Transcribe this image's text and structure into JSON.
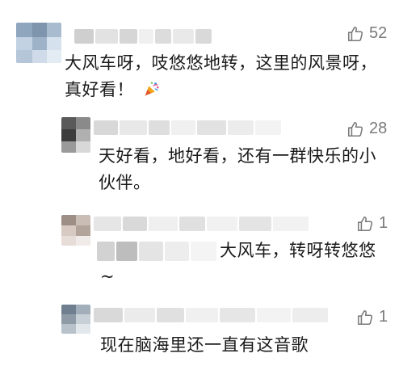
{
  "comments": [
    {
      "likes": "52",
      "lines": [
        "大风车呀，吱悠悠地转，这里的风景呀，",
        "真好看！"
      ],
      "emoji_icon": "party-popper-icon"
    },
    {
      "likes": "28",
      "lines": [
        "天好看，地好看，还有一群快乐的小",
        "伙伴。"
      ]
    },
    {
      "likes": "1",
      "lines": [
        "大风车，转呀转悠悠",
        "~"
      ]
    },
    {
      "likes": "1",
      "lines": [
        "现在脑海里还一直有这音歌"
      ]
    }
  ],
  "colors": {
    "like_gray": "#7a7a7a",
    "text": "#1a1a1a",
    "blur_light": "#e6e6e6",
    "blur_mid": "#d2d2d2"
  },
  "icons": {
    "like": "thumbs-up-icon"
  }
}
